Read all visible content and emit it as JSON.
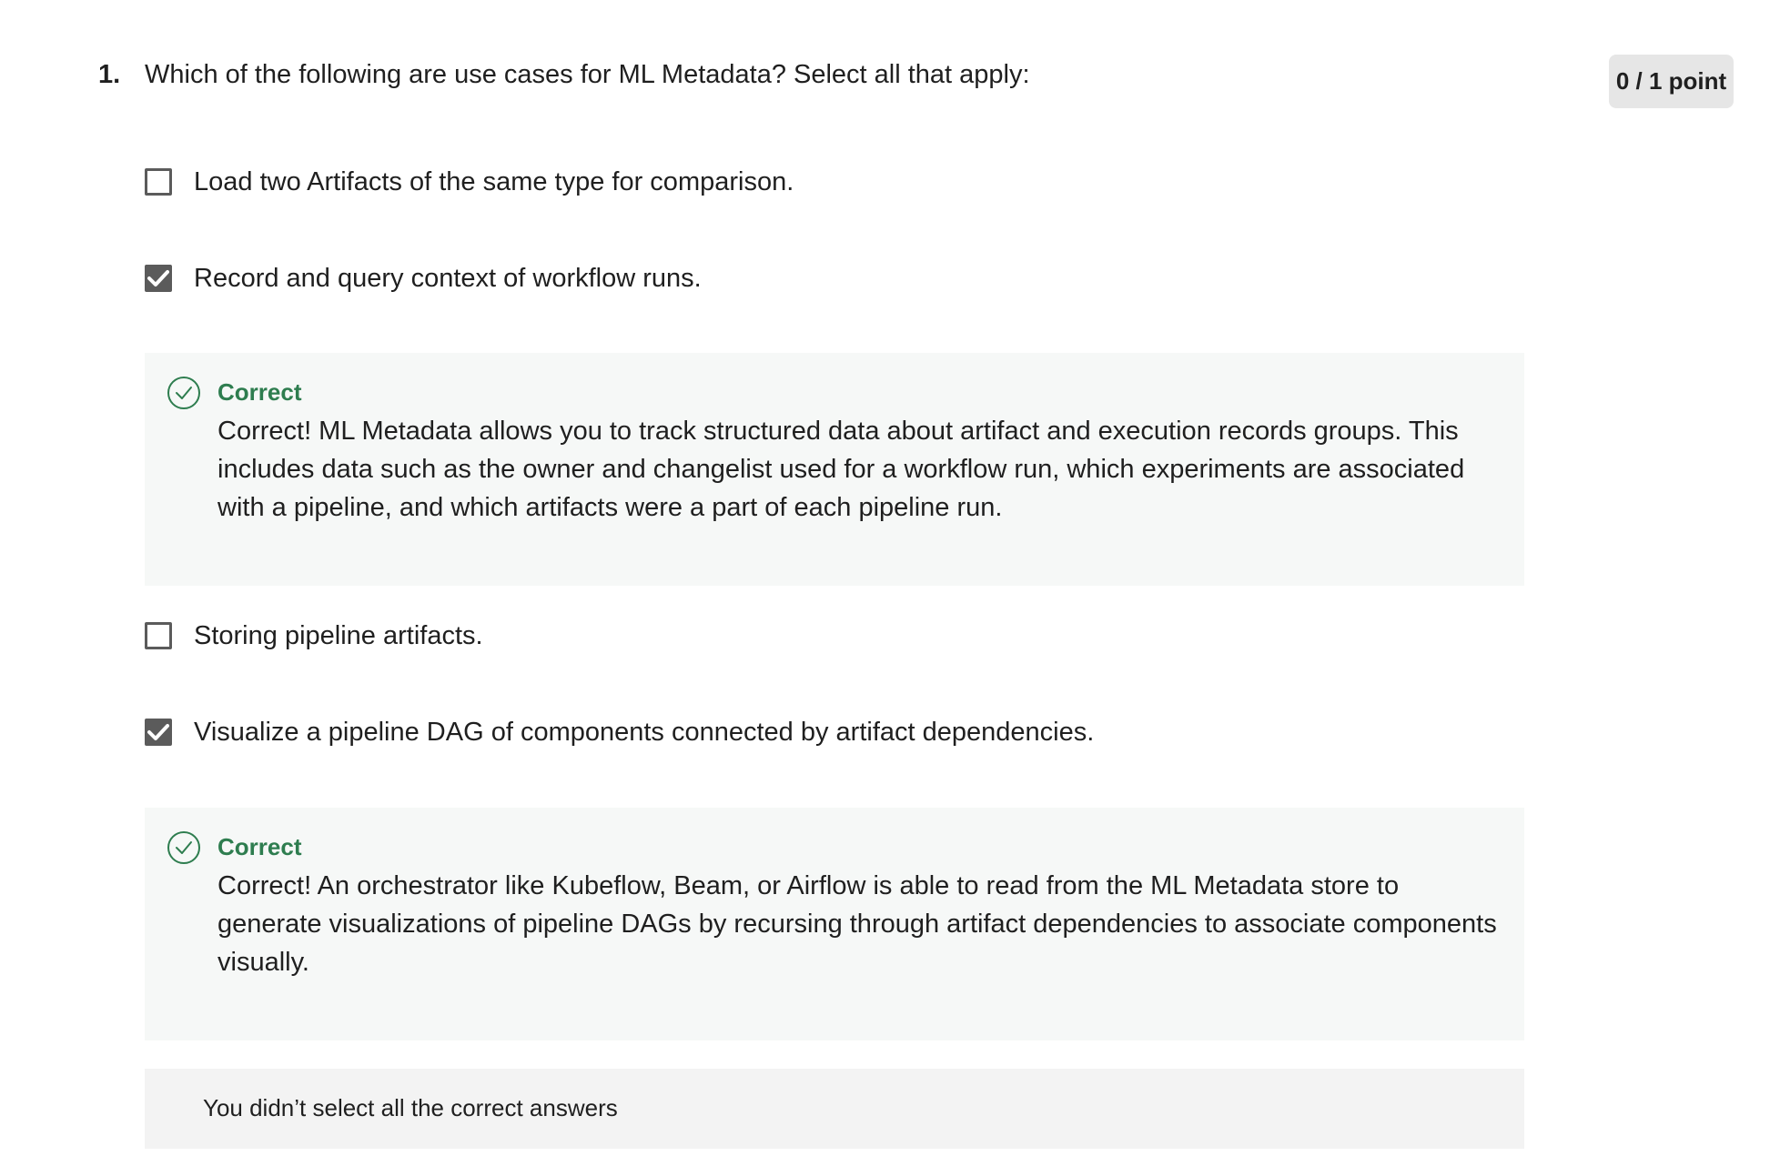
{
  "question": {
    "number": "1.",
    "text": "Which of the following are use cases for ML Metadata? Select all that apply:",
    "score": "0 / 1 point"
  },
  "options": [
    {
      "label": "Load two Artifacts of the same type for comparison.",
      "checked": false
    },
    {
      "label": "Record and query context of workflow runs.",
      "checked": true
    },
    {
      "label": "Storing pipeline artifacts.",
      "checked": false
    },
    {
      "label": "Visualize a pipeline DAG of components connected by artifact dependencies.",
      "checked": true
    }
  ],
  "feedback": [
    {
      "title": "Correct",
      "text": "Correct! ML Metadata allows you to track structured data about artifact and execution records groups. This includes data such as the owner and changelist used for a workflow run, which experiments are associated with a pipeline, and which artifacts were a part of each pipeline run."
    },
    {
      "title": "Correct",
      "text": "Correct! An orchestrator like Kubeflow, Beam, or Airflow is able to read from the ML Metadata store to generate visualizations of pipeline DAGs by recursing through artifact dependencies to associate components visually."
    }
  ],
  "summary": {
    "text": "You didn’t select all the correct answers"
  },
  "colors": {
    "correct_green": "#2e7d4f",
    "checkbox_gray": "#5b5b5b",
    "feedback_bg": "#f6f8f7",
    "summary_bg": "#f3f3f3",
    "score_badge_bg": "#e6e6e6"
  },
  "icons": {
    "checkbox_checked": "check-icon",
    "feedback": "check-circle-icon"
  }
}
